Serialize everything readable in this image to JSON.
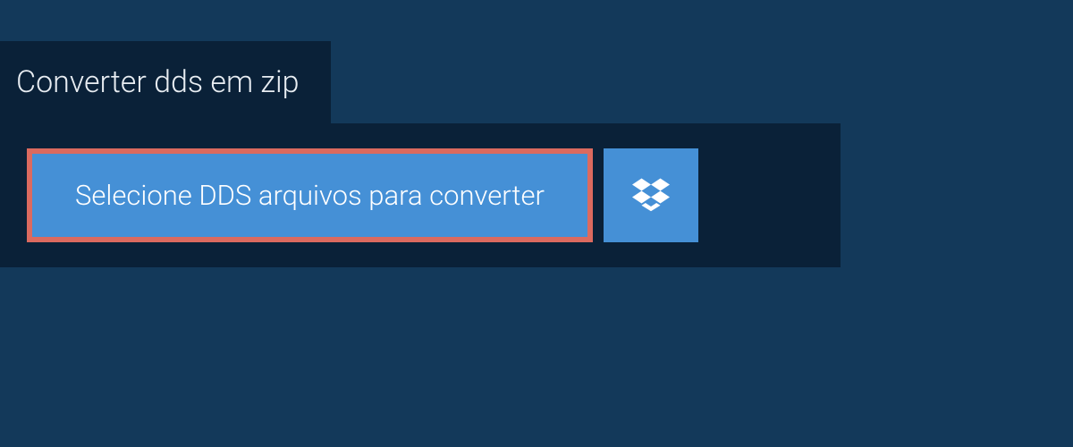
{
  "header": {
    "title": "Converter dds em zip"
  },
  "actions": {
    "select_files_label": "Selecione DDS arquivos para converter"
  },
  "colors": {
    "background": "#13395a",
    "panel": "#0a2138",
    "button": "#4590d6",
    "highlight_border": "#db6a5f",
    "text_light": "#ffffff"
  }
}
